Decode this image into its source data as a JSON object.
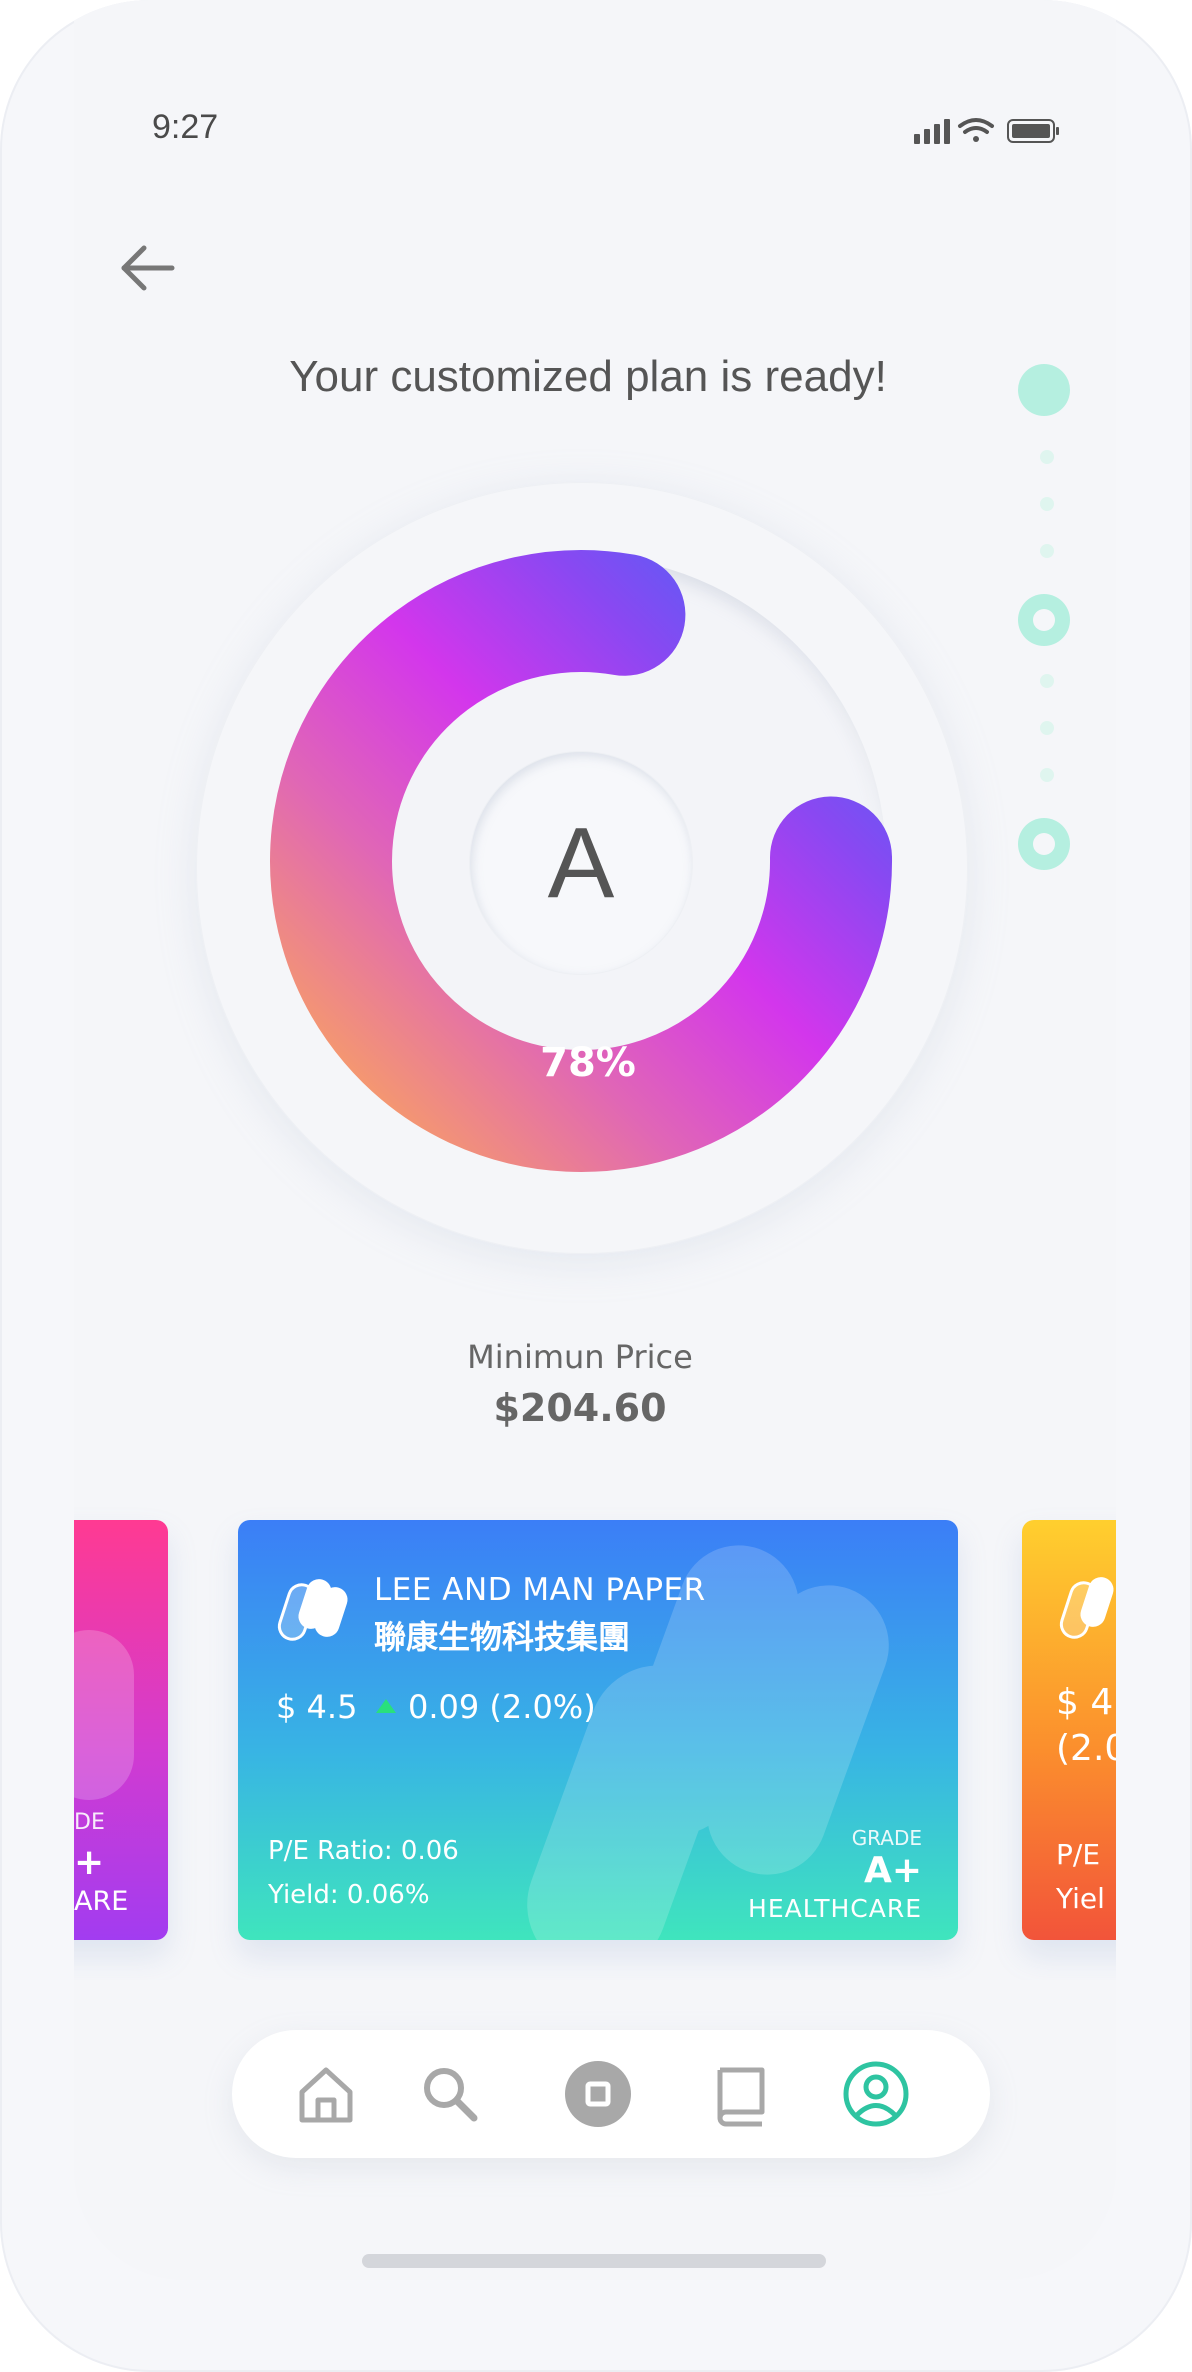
{
  "status_bar": {
    "time": "9:27",
    "icons": [
      "signal-icon",
      "wifi-icon",
      "battery-icon"
    ]
  },
  "header": {
    "back_icon": "arrow-left-icon",
    "title": "Your customized plan is ready!"
  },
  "stepper": {
    "steps": 3,
    "current_step": 1
  },
  "gauge": {
    "grade": "A",
    "percent_label": "78%",
    "progress": 0.78,
    "gradient_colors": [
      "#f9a360",
      "#e066b6",
      "#d336ec",
      "#8a48f2",
      "#4a64f6"
    ]
  },
  "price": {
    "label": "Minimun Price",
    "value": "$204.60"
  },
  "cards": {
    "left": {
      "grade_label": "DE",
      "grade": "+",
      "sector": "ARE",
      "colors": [
        "#ff3a92",
        "#a23cf0"
      ]
    },
    "main": {
      "icon": "capsule-icon",
      "name": "LEE AND MAN PAPER",
      "name_cn": "聯康生物科技集團",
      "price": "$ 4.5",
      "change": "0.09 (2.0%)",
      "change_direction": "up",
      "pe_ratio": "P/E Ratio: 0.06",
      "yield": "Yield: 0.06%",
      "grade_label": "GRADE",
      "grade": "A+",
      "sector": "HEALTHCARE",
      "colors": [
        "#3b7ef7",
        "#3fe5bd"
      ]
    },
    "right": {
      "price": "$ 4",
      "change": "(2.0",
      "pe": "P/E",
      "yield": "Yiel",
      "colors": [
        "#ffcf2e",
        "#f2543a"
      ]
    }
  },
  "navbar": {
    "items": [
      {
        "icon": "home-icon",
        "active": false
      },
      {
        "icon": "search-icon",
        "active": false
      },
      {
        "icon": "stop-icon",
        "active": false
      },
      {
        "icon": "book-icon",
        "active": false
      },
      {
        "icon": "user-circle-icon",
        "active": true
      }
    ],
    "active_color": "#2ec4a1",
    "inactive_color": "#a8a8a8"
  }
}
